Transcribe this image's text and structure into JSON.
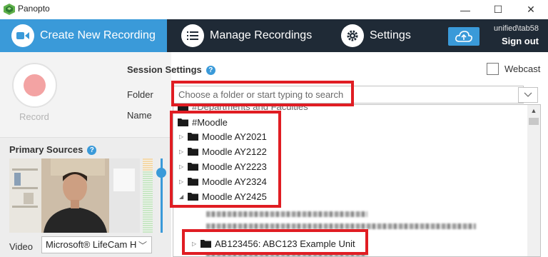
{
  "window": {
    "title": "Panopto",
    "minimize_glyph": "—",
    "maximize_glyph": "☐",
    "close_glyph": "✕"
  },
  "nav": {
    "create_label": "Create New Recording",
    "manage_label": "Manage Recordings",
    "settings_label": "Settings",
    "user": "unified\\tab58",
    "sign_out": "Sign out"
  },
  "record": {
    "label": "Record"
  },
  "primary_sources": {
    "title": "Primary Sources",
    "help": "?",
    "video_label": "Video",
    "video_value": "Microsoft® LifeCam H"
  },
  "session": {
    "title": "Session Settings",
    "help": "?",
    "webcast_label": "Webcast",
    "webcast_checked": false,
    "folder_label": "Folder",
    "folder_placeholder": "Choose a folder or start typing to search",
    "name_label": "Name"
  },
  "folders": {
    "items": [
      {
        "label": "#Departments and Faculties",
        "expanded": false
      },
      {
        "label": "#Moodle",
        "expanded": true
      },
      {
        "label": "Moodle AY2021",
        "expanded": false
      },
      {
        "label": "Moodle AY2122",
        "expanded": false
      },
      {
        "label": "Moodle AY2223",
        "expanded": false
      },
      {
        "label": "Moodle AY2324",
        "expanded": false
      },
      {
        "label": "Moodle AY2425",
        "expanded": true
      },
      {
        "label": "AB123456: ABC123 Example Unit",
        "expanded": false
      }
    ]
  },
  "colors": {
    "nav_bg": "#1f2a36",
    "accent": "#3a9ad9",
    "highlight": "#e01d23",
    "record": "#f3a3a3"
  }
}
